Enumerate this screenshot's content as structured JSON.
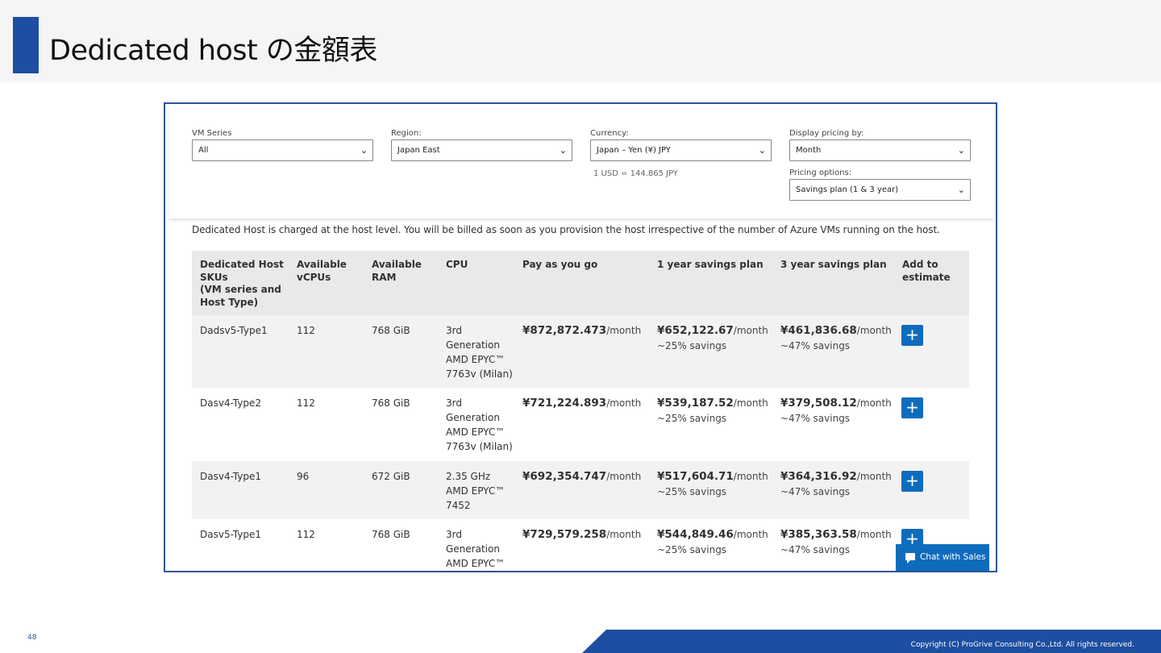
{
  "slide": {
    "title": "Dedicated host の金額表",
    "page_number": "48",
    "copyright": "Copyright (C) ProGrive Consulting Co.,Ltd. All rights reserved.",
    "accent_color": "#1e4ea1"
  },
  "filters": {
    "vm_series": {
      "label": "VM Series",
      "value": "All"
    },
    "region": {
      "label": "Region:",
      "value": "Japan East"
    },
    "currency": {
      "label": "Currency:",
      "value": "Japan – Yen (¥) JPY"
    },
    "display": {
      "label": "Display pricing by:",
      "value": "Month"
    },
    "pricing_options": {
      "label": "Pricing options:",
      "value": "Savings plan (1 & 3 year)"
    },
    "rate_note": "1 USD = 144.865 JPY"
  },
  "intro": "Dedicated Host is charged at the host level. You will be billed as soon as you provision the host irrespective of the number of Azure VMs running on the host.",
  "table": {
    "headers": {
      "sku": "Dedicated Host\nSKUs\n(VM series and\nHost Type)",
      "vcpus": "Available\nvCPUs",
      "ram": "Available\nRAM",
      "cpu": "CPU",
      "payg": "Pay as you go",
      "one_year": "1 year savings plan",
      "three_year": "3 year savings plan",
      "add": "Add to\nestimate"
    },
    "unit": "/month",
    "rows": [
      {
        "sku": "Dadsv5-Type1",
        "vcpus": "112",
        "ram": "768 GiB",
        "cpu": "3rd\nGeneration\nAMD EPYC™\n7763v (Milan)",
        "payg": "¥872,872.473",
        "one_year": "¥652,122.67",
        "one_year_saving": "~25% savings",
        "three_year": "¥461,836.68",
        "three_year_saving": "~47% savings"
      },
      {
        "sku": "Dasv4-Type2",
        "vcpus": "112",
        "ram": "768 GiB",
        "cpu": "3rd\nGeneration\nAMD EPYC™\n7763v (Milan)",
        "payg": "¥721,224.893",
        "one_year": "¥539,187.52",
        "one_year_saving": "~25% savings",
        "three_year": "¥379,508.12",
        "three_year_saving": "~47% savings"
      },
      {
        "sku": "Dasv4-Type1",
        "vcpus": "96",
        "ram": "672 GiB",
        "cpu": "2.35 GHz\nAMD EPYC™\n7452",
        "payg": "¥692,354.747",
        "one_year": "¥517,604.71",
        "one_year_saving": "~25% savings",
        "three_year": "¥364,316.92",
        "three_year_saving": "~47% savings"
      },
      {
        "sku": "Dasv5-Type1",
        "vcpus": "112",
        "ram": "768 GiB",
        "cpu": "3rd\nGeneration\nAMD EPYC™",
        "payg": "¥729,579.258",
        "one_year": "¥544,849.46",
        "one_year_saving": "~25% savings",
        "three_year": "¥385,363.58",
        "three_year_saving": "~47% savings"
      }
    ],
    "add_label": "+"
  },
  "chat": {
    "label": "Chat with Sales",
    "icon": "chat-bubble-icon"
  }
}
